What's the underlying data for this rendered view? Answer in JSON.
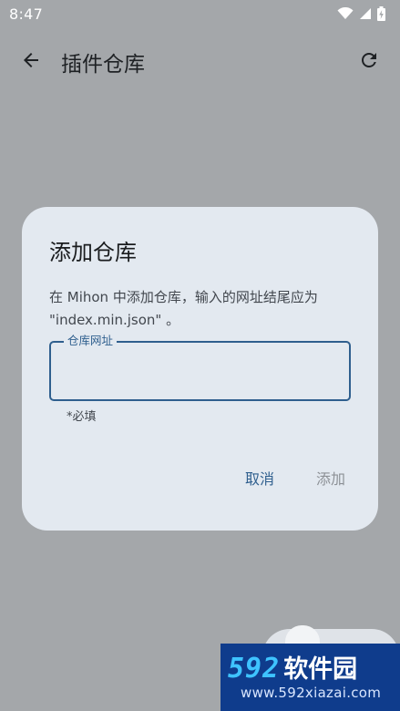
{
  "status_bar": {
    "time": "8:47",
    "icons": [
      "wifi-icon",
      "signal-icon",
      "battery-charging-icon"
    ]
  },
  "app_bar": {
    "title": "插件仓库",
    "back_icon": "arrow-left-icon",
    "refresh_icon": "refresh-icon"
  },
  "dialog": {
    "title": "添加仓库",
    "description": "在 Mihon 中添加仓库，输入的网址结尾应为 \"index.min.json\" 。",
    "field": {
      "label": "仓库网址",
      "value": "",
      "placeholder": ""
    },
    "helper": "*必填",
    "actions": {
      "cancel": "取消",
      "add": "添加"
    }
  },
  "watermark": {
    "number": "592",
    "name": "软件园",
    "url": "www.592xiazai.com"
  },
  "colors": {
    "scrim_background": "#a4a7aa",
    "dialog_surface": "#e3e9f0",
    "primary": "#2f5f8e",
    "disabled_text": "#8d9196",
    "watermark_bg": "#0f3c8c",
    "watermark_accent": "#3ec3ff"
  }
}
